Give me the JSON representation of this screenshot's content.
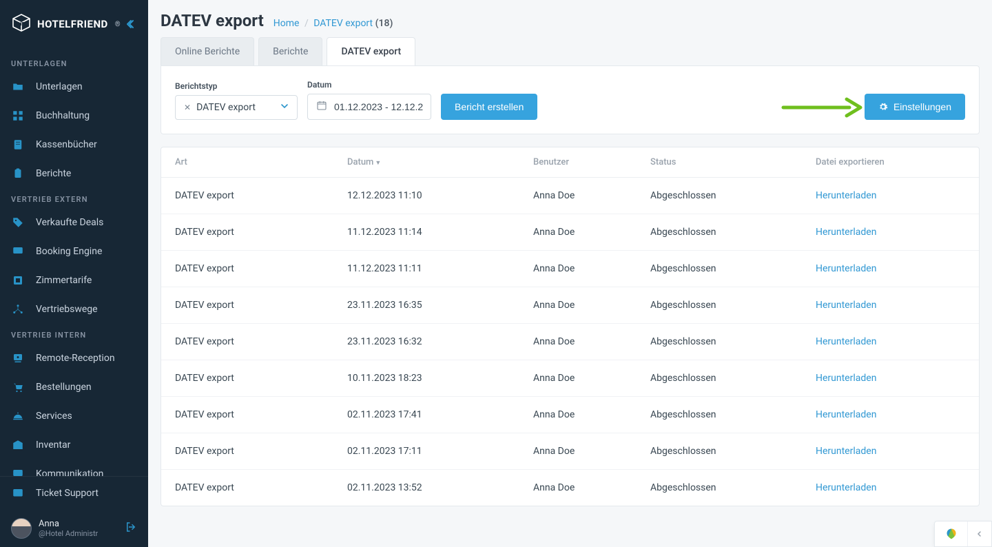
{
  "brand": {
    "name": "HOTELFRIEND"
  },
  "sidebar": {
    "sections": [
      {
        "title": "UNTERLAGEN",
        "items": [
          {
            "label": "Unterlagen",
            "icon": "folder-icon"
          },
          {
            "label": "Buchhaltung",
            "icon": "grid-icon"
          },
          {
            "label": "Kassenbücher",
            "icon": "cashbook-icon"
          },
          {
            "label": "Berichte",
            "icon": "clipboard-icon"
          }
        ]
      },
      {
        "title": "VERTRIEB EXTERN",
        "items": [
          {
            "label": "Verkaufte Deals",
            "icon": "tag-icon"
          },
          {
            "label": "Booking Engine",
            "icon": "monitor-icon"
          },
          {
            "label": "Zimmertarife",
            "icon": "rate-icon"
          },
          {
            "label": "Vertriebswege",
            "icon": "network-icon"
          }
        ]
      },
      {
        "title": "VERTRIEB INTERN",
        "items": [
          {
            "label": "Remote-Reception",
            "icon": "reception-icon"
          },
          {
            "label": "Bestellungen",
            "icon": "cart-icon"
          },
          {
            "label": "Services",
            "icon": "services-icon"
          },
          {
            "label": "Inventar",
            "icon": "inventory-icon"
          },
          {
            "label": "Kommunikation",
            "icon": "chat-icon"
          }
        ]
      }
    ],
    "ticket_support": "Ticket Support",
    "user": {
      "name": "Anna",
      "subtitle": "@Hotel Administr"
    }
  },
  "header": {
    "title": "DATEV export",
    "home": "Home",
    "current": "DATEV export",
    "count": "(18)"
  },
  "tabs": [
    {
      "label": "Online Berichte"
    },
    {
      "label": "Berichte"
    },
    {
      "label": "DATEV export"
    }
  ],
  "filter": {
    "report_type_label": "Berichtstyp",
    "report_type_value": "DATEV export",
    "date_label": "Datum",
    "date_value": "01.12.2023 - 12.12.2",
    "create_button": "Bericht erstellen",
    "settings_button": "Einstellungen"
  },
  "table": {
    "headers": {
      "art": "Art",
      "datum": "Datum",
      "benutzer": "Benutzer",
      "status": "Status",
      "export": "Datei exportieren"
    },
    "download_label": "Herunterladen",
    "rows": [
      {
        "art": "DATEV export",
        "datum": "12.12.2023 11:10",
        "user": "Anna Doe",
        "status": "Abgeschlossen"
      },
      {
        "art": "DATEV export",
        "datum": "11.12.2023 11:14",
        "user": "Anna Doe",
        "status": "Abgeschlossen"
      },
      {
        "art": "DATEV export",
        "datum": "11.12.2023 11:11",
        "user": "Anna Doe",
        "status": "Abgeschlossen"
      },
      {
        "art": "DATEV export",
        "datum": "23.11.2023 16:35",
        "user": "Anna Doe",
        "status": "Abgeschlossen"
      },
      {
        "art": "DATEV export",
        "datum": "23.11.2023 16:32",
        "user": "Anna Doe",
        "status": "Abgeschlossen"
      },
      {
        "art": "DATEV export",
        "datum": "10.11.2023 18:23",
        "user": "Anna Doe",
        "status": "Abgeschlossen"
      },
      {
        "art": "DATEV export",
        "datum": "02.11.2023 17:41",
        "user": "Anna Doe",
        "status": "Abgeschlossen"
      },
      {
        "art": "DATEV export",
        "datum": "02.11.2023 17:11",
        "user": "Anna Doe",
        "status": "Abgeschlossen"
      },
      {
        "art": "DATEV export",
        "datum": "02.11.2023 13:52",
        "user": "Anna Doe",
        "status": "Abgeschlossen"
      }
    ]
  }
}
